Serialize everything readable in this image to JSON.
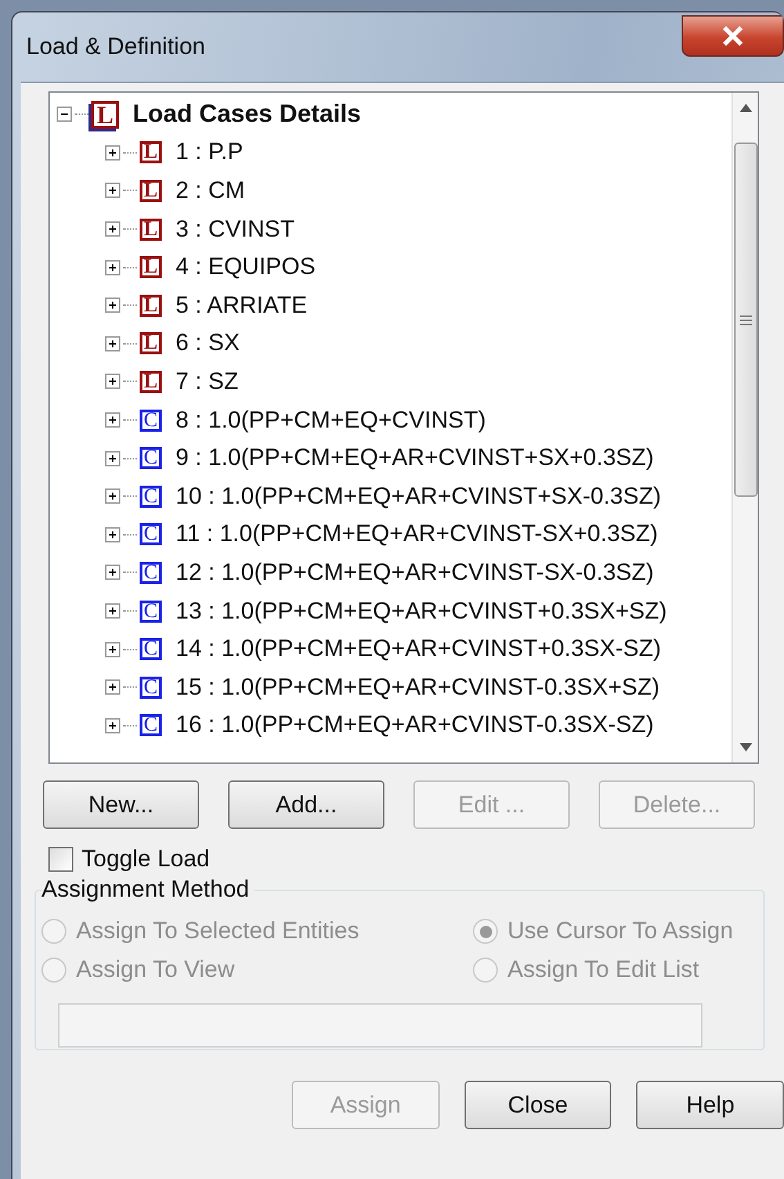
{
  "window": {
    "title": "Load & Definition"
  },
  "tree": {
    "label": "Load Cases Details",
    "badge": "L",
    "kind": "root",
    "expanded": true,
    "children": [
      {
        "label": "1 : P.P",
        "badge": "L",
        "kind": "load",
        "expanded": false
      },
      {
        "label": "2 : CM",
        "badge": "L",
        "kind": "load",
        "expanded": false
      },
      {
        "label": "3 : CVINST",
        "badge": "L",
        "kind": "load",
        "expanded": false
      },
      {
        "label": "4 : EQUIPOS",
        "badge": "L",
        "kind": "load",
        "expanded": false
      },
      {
        "label": "5 : ARRIATE",
        "badge": "L",
        "kind": "load",
        "expanded": false
      },
      {
        "label": "6 : SX",
        "badge": "L",
        "kind": "load",
        "expanded": false
      },
      {
        "label": "7 : SZ",
        "badge": "L",
        "kind": "load",
        "expanded": false
      },
      {
        "label": "8 : 1.0(PP+CM+EQ+CVINST)",
        "badge": "C",
        "kind": "combination",
        "expanded": false
      },
      {
        "label": "9 : 1.0(PP+CM+EQ+AR+CVINST+SX+0.3SZ)",
        "badge": "C",
        "kind": "combination",
        "expanded": false
      },
      {
        "label": "10 : 1.0(PP+CM+EQ+AR+CVINST+SX-0.3SZ)",
        "badge": "C",
        "kind": "combination",
        "expanded": false
      },
      {
        "label": "11 : 1.0(PP+CM+EQ+AR+CVINST-SX+0.3SZ)",
        "badge": "C",
        "kind": "combination",
        "expanded": false
      },
      {
        "label": "12 : 1.0(PP+CM+EQ+AR+CVINST-SX-0.3SZ)",
        "badge": "C",
        "kind": "combination",
        "expanded": false
      },
      {
        "label": "13 : 1.0(PP+CM+EQ+AR+CVINST+0.3SX+SZ)",
        "badge": "C",
        "kind": "combination",
        "expanded": false
      },
      {
        "label": "14 : 1.0(PP+CM+EQ+AR+CVINST+0.3SX-SZ)",
        "badge": "C",
        "kind": "combination",
        "expanded": false
      },
      {
        "label": "15 : 1.0(PP+CM+EQ+AR+CVINST-0.3SX+SZ)",
        "badge": "C",
        "kind": "combination",
        "expanded": false
      },
      {
        "label": "16 : 1.0(PP+CM+EQ+AR+CVINST-0.3SX-SZ)",
        "badge": "C",
        "kind": "combination",
        "expanded": false
      }
    ]
  },
  "tree_buttons": [
    {
      "label": "New...",
      "disabled": false
    },
    {
      "label": "Add...",
      "disabled": false
    },
    {
      "label": "Edit ...",
      "disabled": true
    },
    {
      "label": "Delete...",
      "disabled": true
    }
  ],
  "toggle_load": {
    "label": "Toggle Load",
    "checked": false
  },
  "assignment_method": {
    "title": "Assignment Method",
    "disabled": true,
    "options": [
      {
        "label": "Assign To Selected Entities",
        "selected": false
      },
      {
        "label": "Use Cursor To Assign",
        "selected": true
      },
      {
        "label": "Assign To View",
        "selected": false
      },
      {
        "label": "Assign To Edit List",
        "selected": false
      }
    ]
  },
  "dialog_buttons": [
    {
      "label": "Assign",
      "disabled": true
    },
    {
      "label": "Close",
      "disabled": false
    },
    {
      "label": "Help",
      "disabled": false
    }
  ]
}
